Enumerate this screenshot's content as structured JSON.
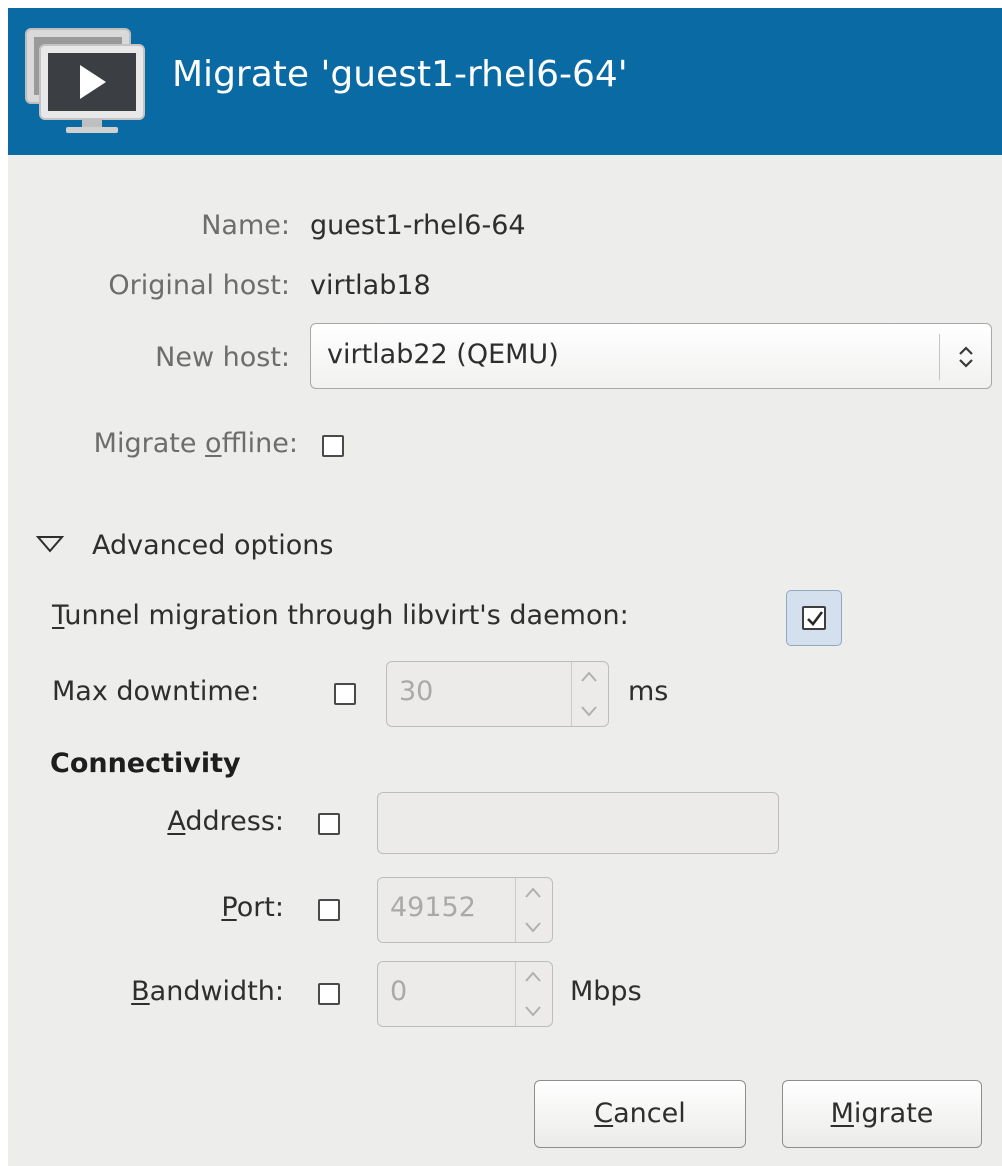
{
  "window": {
    "title": "Migrate 'guest1-rhel6-64'",
    "icon": "vm-monitor-icon"
  },
  "details": {
    "name_label": "Name:",
    "name_value": "guest1-rhel6-64",
    "original_host_label": "Original host:",
    "original_host_value": "virtlab18",
    "new_host_label": "New host:",
    "new_host_value": "virtlab22 (QEMU)"
  },
  "offline": {
    "label_pre": "Migrate ",
    "label_mnemonic": "o",
    "label_post": "ffline:",
    "checked": false
  },
  "advanced": {
    "expander_label": "Advanced options",
    "expanded": true,
    "tunnel": {
      "label_mnemonic": "T",
      "label_post": "unnel migration through libvirt's daemon:",
      "checked": true
    },
    "max_downtime": {
      "label": "Max downtime:",
      "checked": false,
      "value": "30",
      "unit": "ms"
    }
  },
  "connectivity": {
    "heading": "Connectivity",
    "address": {
      "label_mnemonic": "A",
      "label_post": "ddress:",
      "checked": false,
      "value": ""
    },
    "port": {
      "label_mnemonic": "P",
      "label_post": "ort:",
      "checked": false,
      "value": "49152"
    },
    "bandwidth": {
      "label_mnemonic": "B",
      "label_post": "andwidth:",
      "checked": false,
      "value": "0",
      "unit": "Mbps"
    }
  },
  "buttons": {
    "cancel_mnemonic": "C",
    "cancel_post": "ancel",
    "migrate_mnemonic": "M",
    "migrate_post": "igrate"
  },
  "colors": {
    "header_bg": "#0a6aa4",
    "dialog_bg": "#ededeb"
  }
}
